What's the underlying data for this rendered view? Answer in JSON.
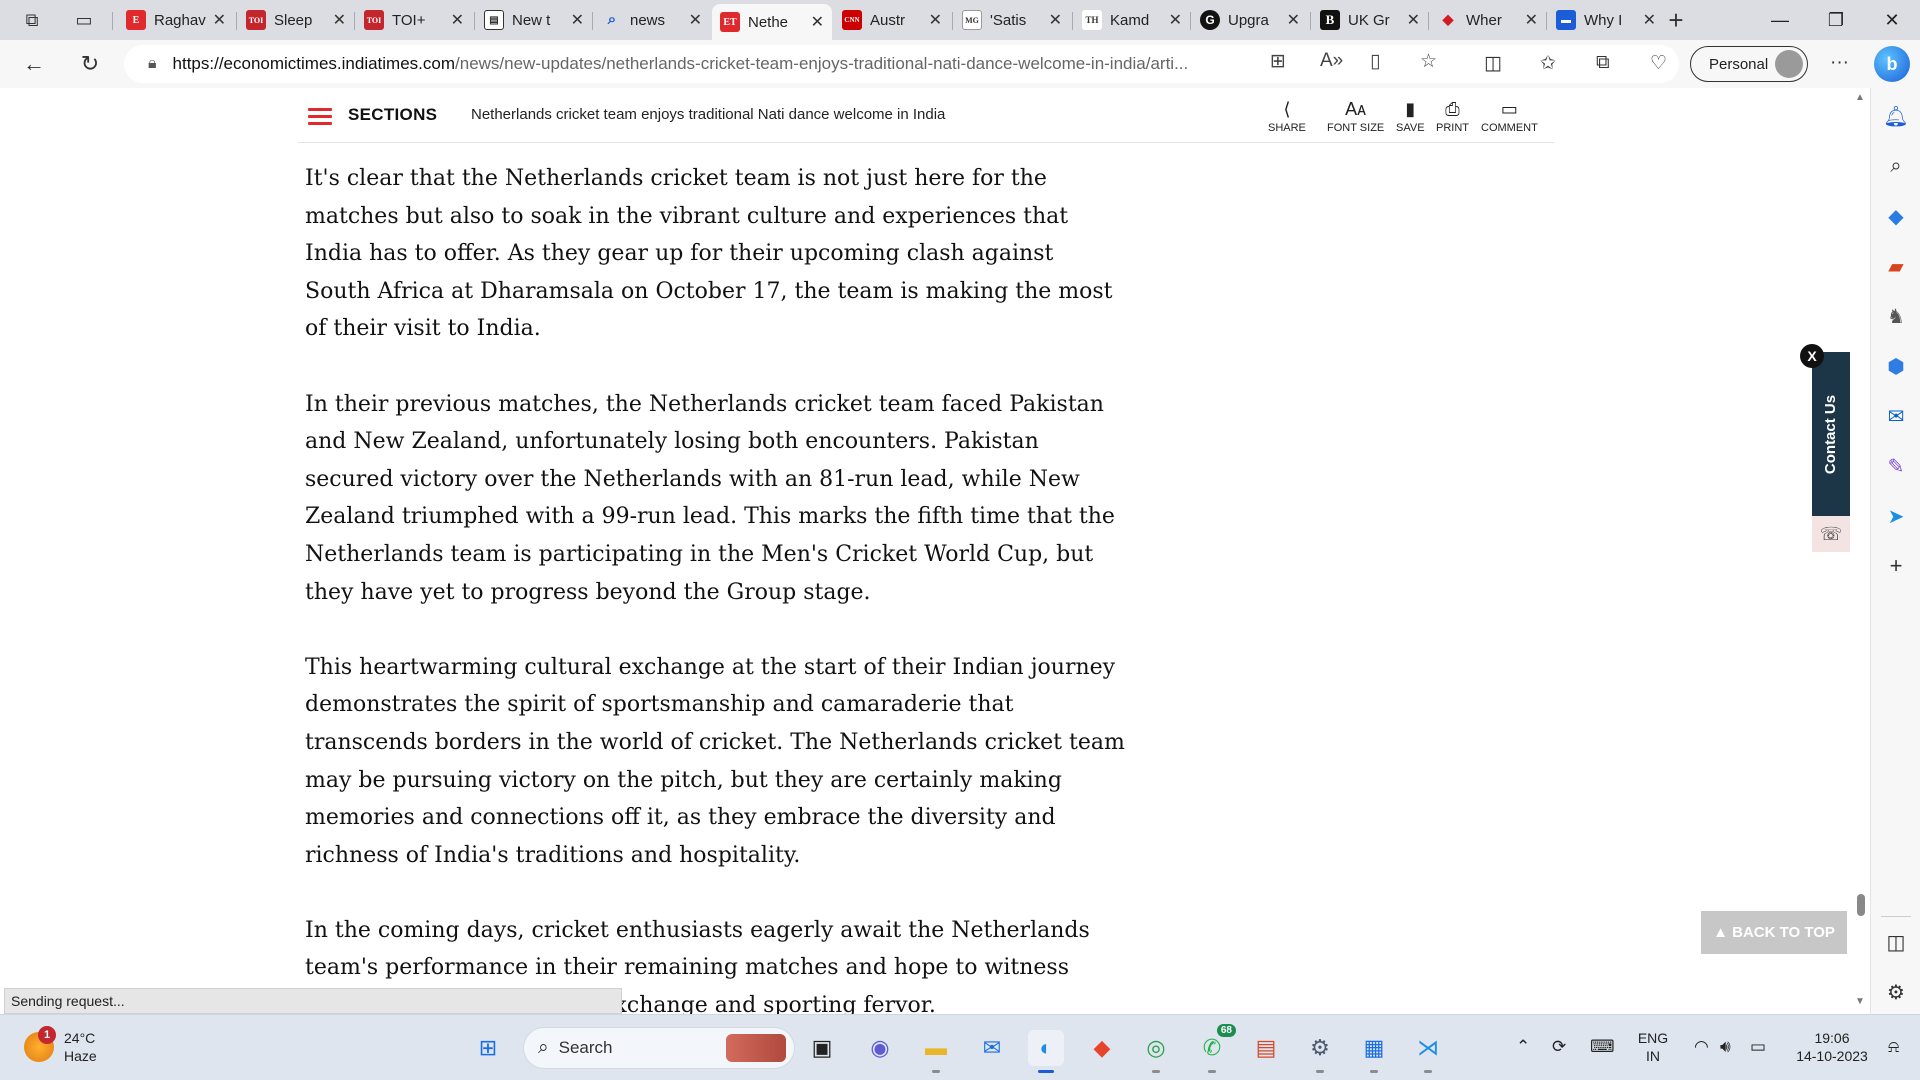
{
  "browser": {
    "tabs": [
      {
        "title": "Raghav",
        "favicon_text": "E",
        "favicon_color": "#e0292d"
      },
      {
        "title": "Sleep",
        "favicon_text": "TOI",
        "favicon_color": "#c4262e"
      },
      {
        "title": "TOI+",
        "favicon_text": "TOI",
        "favicon_color": "#c4262e"
      },
      {
        "title": "New t",
        "favicon_text": "▤",
        "favicon_color": "#444444"
      },
      {
        "title": "news",
        "favicon_text": "Q",
        "favicon_color": "#1a5dd6"
      },
      {
        "title": "Nethe",
        "favicon_text": "ET",
        "favicon_color": "#e0292d",
        "active": true
      },
      {
        "title": "Austr",
        "favicon_text": "CNN",
        "favicon_color": "#cc0000"
      },
      {
        "title": "'Satis",
        "favicon_text": "MG",
        "favicon_color": "#ffffff"
      },
      {
        "title": "Kamd",
        "favicon_text": "TH",
        "favicon_color": "#ffffff"
      },
      {
        "title": "Upgra",
        "favicon_text": "G",
        "favicon_color": "#111111"
      },
      {
        "title": "UK Gr",
        "favicon_text": "B",
        "favicon_color": "#111111"
      },
      {
        "title": "Wher",
        "favicon_text": "◆",
        "favicon_color": "#ffffff"
      },
      {
        "title": "Why I",
        "favicon_text": "▬",
        "favicon_color": "#1a5dd6"
      }
    ],
    "url_host": "https://economictimes.indiatimes.com",
    "url_path": "/news/new-updates/netherlands-cricket-team-enjoys-traditional-nati-dance-welcome-in-india/arti...",
    "profile_label": "Personal",
    "status_text": "Sending request..."
  },
  "site": {
    "sections_label": "SECTIONS",
    "header_title": "Netherlands cricket team enjoys traditional Nati dance welcome in India",
    "tools": {
      "share": "SHARE",
      "font_size": "FONT SIZE",
      "save": "SAVE",
      "print": "PRINT",
      "comment": "COMMENT"
    },
    "article_paragraphs": [
      "It's clear that the Netherlands cricket team is not just here for the matches but also to soak in the vibrant culture and experiences that India has to offer. As they gear up for their upcoming clash against South Africa at Dharamsala on October 17, the team is making the most of their visit to India.",
      "In their previous matches, the Netherlands cricket team faced Pakistan and New Zealand, unfortunately losing both encounters. Pakistan secured victory over the Netherlands with an 81-run lead, while New Zealand triumphed with a 99-run lead. This marks the fifth time that the Netherlands team is participating in the Men's Cricket World Cup, but they have yet to progress beyond the Group stage.",
      "This heartwarming cultural exchange at the start of their Indian journey demonstrates the spirit of sportsmanship and camaraderie that transcends borders in the world of cricket. The Netherlands cricket team may be pursuing victory on the pitch, but they are certainly making memories and connections off it, as they embrace the diversity and richness of India's traditions and hospitality.",
      "In the coming days, cricket enthusiasts eagerly await the Netherlands team's performance in their remaining matches and hope to witness more moments of cultural exchange and sporting fervor."
    ],
    "contact_label": "Contact Us",
    "contact_close": "X",
    "back_to_top": "▲ BACK TO TOP"
  },
  "taskbar": {
    "weather_temp": "24°C",
    "weather_desc": "Haze",
    "weather_badge": "1",
    "search_label": "Search",
    "whatsapp_badge": "68",
    "lang_line1": "ENG",
    "lang_line2": "IN",
    "time": "19:06",
    "date": "14-10-2023"
  },
  "colors": {
    "accent": "#e0292d",
    "contact_bg": "#1c3648",
    "edge_blue": "#1a5dd6"
  }
}
